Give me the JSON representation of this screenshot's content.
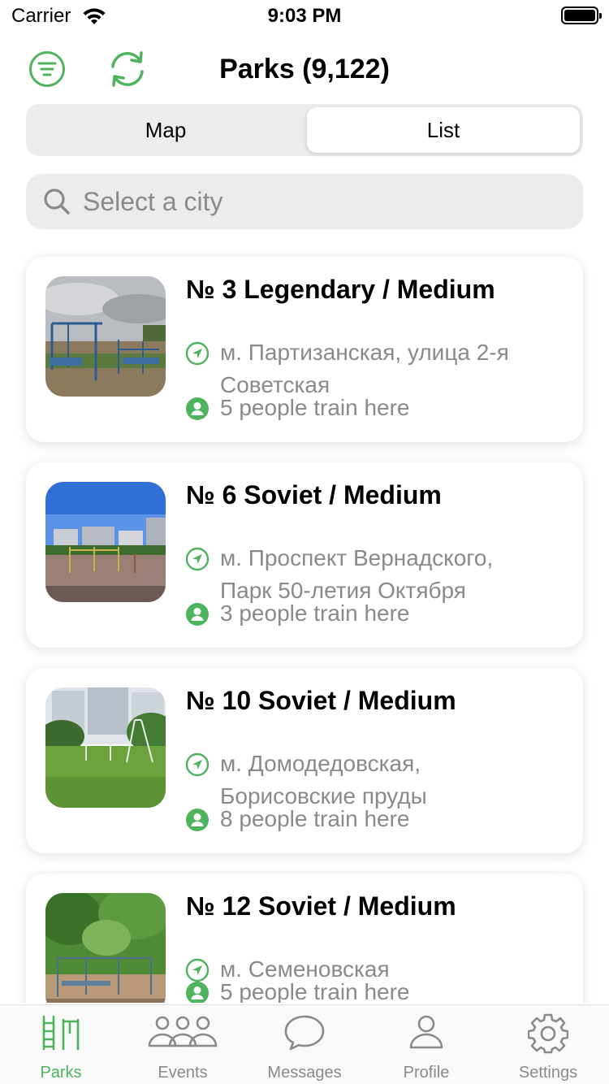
{
  "status_bar": {
    "carrier": "Carrier",
    "time": "9:03 PM"
  },
  "nav": {
    "title": "Parks (9,122)"
  },
  "segmented": {
    "map": "Map",
    "list": "List",
    "selected": "List"
  },
  "search": {
    "placeholder": "Select a city",
    "value": ""
  },
  "parks": [
    {
      "title": "№ 3 Legendary / Medium",
      "address": "м. Партизанская, улица 2-я Советская",
      "people": "5 people train here"
    },
    {
      "title": "№ 6 Soviet / Medium",
      "address": "м. Проспект Вернадского, Парк 50-летия Октября",
      "people": "3 people train here"
    },
    {
      "title": "№ 10 Soviet / Medium",
      "address": "м. Домодедовская, Борисовские пруды",
      "people": "8 people train here"
    },
    {
      "title": "№ 12 Soviet / Medium",
      "address": "м. Семеновская",
      "people": "5 people train here"
    }
  ],
  "tabs": [
    {
      "label": "Parks",
      "icon": "parks-icon",
      "active": true
    },
    {
      "label": "Events",
      "icon": "people-group-icon",
      "active": false
    },
    {
      "label": "Messages",
      "icon": "chat-bubble-icon",
      "active": false
    },
    {
      "label": "Profile",
      "icon": "person-icon",
      "active": false
    },
    {
      "label": "Settings",
      "icon": "gear-icon",
      "active": false
    }
  ],
  "colors": {
    "accent": "#4db35d",
    "secondary_text": "#8a8a8e",
    "control_bg": "#ececec"
  }
}
